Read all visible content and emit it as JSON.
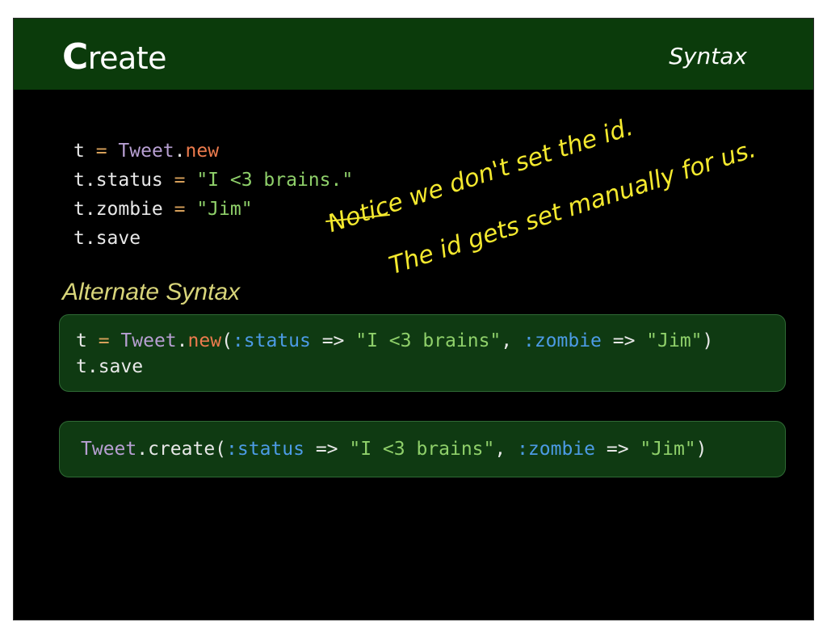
{
  "header": {
    "title_first": "C",
    "title_rest": "reate",
    "subtitle": "Syntax"
  },
  "code1": {
    "lines": [
      [
        {
          "t": "t ",
          "c": "plain"
        },
        {
          "t": "= ",
          "c": "op"
        },
        {
          "t": "Tweet",
          "c": "class"
        },
        {
          "t": ".",
          "c": "plain"
        },
        {
          "t": "new",
          "c": "method"
        }
      ],
      [
        {
          "t": "t.status ",
          "c": "plain"
        },
        {
          "t": "= ",
          "c": "op"
        },
        {
          "t": "\"I <3 brains.\"",
          "c": "string"
        }
      ],
      [
        {
          "t": "t.zombie ",
          "c": "plain"
        },
        {
          "t": "= ",
          "c": "op"
        },
        {
          "t": "\"Jim\"",
          "c": "string"
        }
      ],
      [
        {
          "t": "t.save",
          "c": "plain"
        }
      ]
    ]
  },
  "note": {
    "line1": "Notice we don't set the id.",
    "line2": "The id gets set manually for us."
  },
  "alt": {
    "title": "Alternate Syntax"
  },
  "code2": {
    "lines": [
      [
        {
          "t": "t ",
          "c": "plain"
        },
        {
          "t": "= ",
          "c": "op"
        },
        {
          "t": "Tweet",
          "c": "class"
        },
        {
          "t": ".",
          "c": "plain"
        },
        {
          "t": "new",
          "c": "method"
        },
        {
          "t": "(",
          "c": "plain"
        },
        {
          "t": ":status",
          "c": "symbol"
        },
        {
          "t": " => ",
          "c": "plain"
        },
        {
          "t": "\"I <3 brains\"",
          "c": "string"
        },
        {
          "t": ", ",
          "c": "plain"
        },
        {
          "t": ":zombie",
          "c": "symbol"
        },
        {
          "t": " => ",
          "c": "plain"
        },
        {
          "t": "\"Jim\"",
          "c": "string"
        },
        {
          "t": ")",
          "c": "plain"
        }
      ],
      [
        {
          "t": "t.save",
          "c": "plain"
        }
      ]
    ]
  },
  "code3": {
    "lines": [
      [
        {
          "t": "Tweet",
          "c": "class"
        },
        {
          "t": ".create(",
          "c": "plain"
        },
        {
          "t": ":status",
          "c": "symbol"
        },
        {
          "t": " => ",
          "c": "plain"
        },
        {
          "t": "\"I <3 brains\"",
          "c": "string"
        },
        {
          "t": ", ",
          "c": "plain"
        },
        {
          "t": ":zombie",
          "c": "symbol"
        },
        {
          "t": " => ",
          "c": "plain"
        },
        {
          "t": "\"Jim\"",
          "c": "string"
        },
        {
          "t": ")",
          "c": "plain"
        }
      ]
    ]
  },
  "colors": {
    "background": "#000000",
    "header": "#0b3b0b",
    "box": "#0f3a12",
    "string": "#8fd06a",
    "symbol": "#4c9be5",
    "class": "#b79fd2",
    "method": "#ec7b4d",
    "op": "#d7a05a",
    "note": "#f4e92e"
  }
}
